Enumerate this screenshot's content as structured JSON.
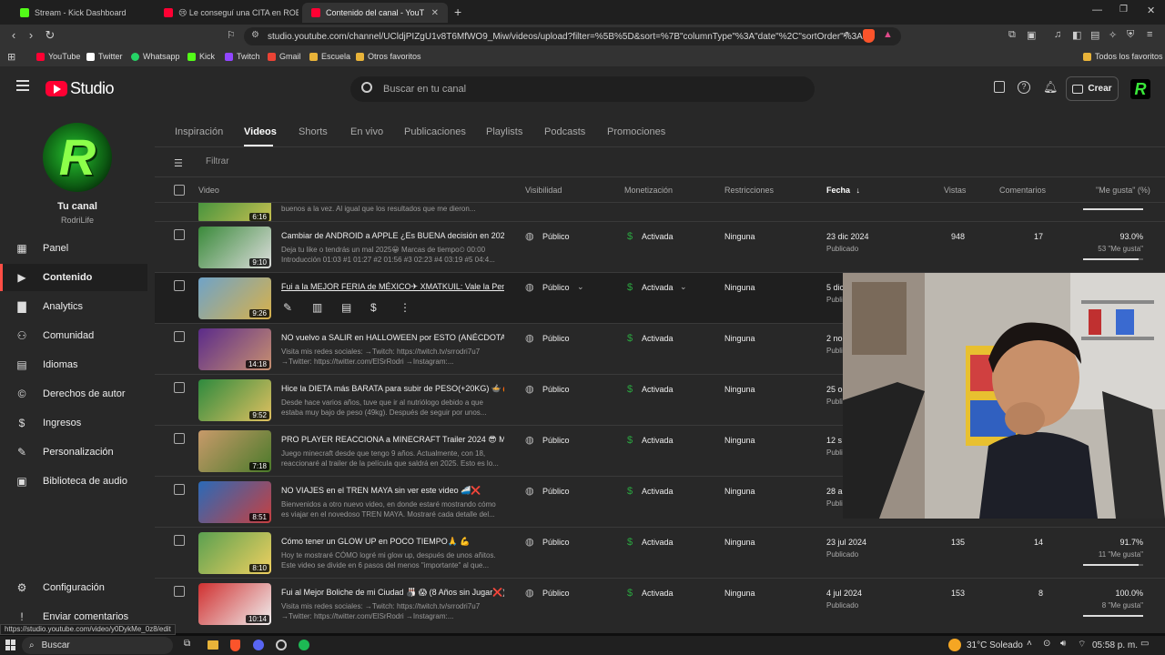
{
  "browser": {
    "tabs": [
      {
        "title": "Stream - Kick Dashboard",
        "active": false,
        "color": "#53fc18"
      },
      {
        "title": "😢 Le conseguí una CITA en ROBLOX",
        "active": false,
        "color": "#ff0033"
      },
      {
        "title": "Contenido del canal - YouTube S",
        "active": true,
        "color": "#ff0033"
      }
    ],
    "url": "studio.youtube.com/channel/UCldjPIZgU1v8T6MfWO9_Miw/videos/upload?filter=%5B%5D&sort=%7B\"columnType\"%3A\"date\"%2C\"sortOrder\"%3A\"...",
    "bookmarks": [
      {
        "label": "YouTube",
        "color": "#ff0033"
      },
      {
        "label": "Twitter",
        "color": "#ffffff"
      },
      {
        "label": "Whatsapp",
        "color": "#25d366"
      },
      {
        "label": "Kick",
        "color": "#53fc18"
      },
      {
        "label": "Twitch",
        "color": "#9146ff"
      },
      {
        "label": "Gmail",
        "color": "#ea4335"
      },
      {
        "label": "Escuela",
        "color": "#e8b339"
      },
      {
        "label": "Otros favoritos",
        "color": "#e8b339"
      }
    ],
    "all_favorites": "Todos los favoritos"
  },
  "studio": {
    "logo_text": "Studio",
    "search_placeholder": "Buscar en tu canal",
    "create_label": "Crear"
  },
  "channel": {
    "title": "Tu canal",
    "name": "RodriLife"
  },
  "sidebar": {
    "items": [
      {
        "label": "Panel",
        "icon": "dashboard-icon",
        "glyph": "▦"
      },
      {
        "label": "Contenido",
        "icon": "content-icon",
        "glyph": "▶",
        "active": true
      },
      {
        "label": "Analytics",
        "icon": "analytics-icon",
        "glyph": "▇"
      },
      {
        "label": "Comunidad",
        "icon": "community-icon",
        "glyph": "⚇"
      },
      {
        "label": "Idiomas",
        "icon": "subtitles-icon",
        "glyph": "▤"
      },
      {
        "label": "Derechos de autor",
        "icon": "copyright-icon",
        "glyph": "©"
      },
      {
        "label": "Ingresos",
        "icon": "earn-icon",
        "glyph": "$"
      },
      {
        "label": "Personalización",
        "icon": "customization-icon",
        "glyph": "✎"
      },
      {
        "label": "Biblioteca de audio",
        "icon": "audio-library-icon",
        "glyph": "▣"
      }
    ],
    "settings": "Configuración",
    "feedback": "Enviar comentarios"
  },
  "content_tabs": [
    "Inspiración",
    "Videos",
    "Shorts",
    "En vivo",
    "Publicaciones",
    "Playlists",
    "Podcasts",
    "Promociones"
  ],
  "filter_placeholder": "Filtrar",
  "columns": {
    "video": "Video",
    "visibility": "Visibilidad",
    "monetization": "Monetización",
    "restrictions": "Restricciones",
    "date": "Fecha",
    "views": "Vistas",
    "comments": "Comentarios",
    "likes": "\"Me gusta\" (%)"
  },
  "partial_row": {
    "duration": "6:16",
    "desc": "buenos a la vez. Al igual que los resultados que me dieron..."
  },
  "videos": [
    {
      "title": "Cambiar de ANDROID a APPLE ¿Es BUENA decisión en 2025...",
      "desc1": "Deja tu like o tendrás un mal 2025😀 Marcas de tiempo⏲ 00:00",
      "desc2": "Introducción 01:03 #1 01:27 #2 01:56 #3 02:23 #4 03:19 #5 04:4...",
      "duration": "9:10",
      "visibility": "Público",
      "monetization": "Activada",
      "restrictions": "Ninguna",
      "date": "23 dic 2024",
      "status": "Publicado",
      "views": "948",
      "comments": "17",
      "likes_pct": "93.0%",
      "likes_count": "53 \"Me gusta\"",
      "likes_fraction": 0.93,
      "thumb": [
        "#3a8a3a",
        "#ddd"
      ]
    },
    {
      "title": "Fui a la MEJOR FERIA de MÉXICO✈ XMATKUIL: Vale la Pena?",
      "desc1": "",
      "desc2": "",
      "duration": "9:26",
      "visibility": "Público",
      "monetization": "Activada",
      "restrictions": "Ninguna",
      "date": "5 dic",
      "status": "Publi",
      "views": "",
      "comments": "",
      "likes_pct": "",
      "likes_count": "",
      "likes_fraction": 0,
      "thumb": [
        "#6fa3c8",
        "#d8b14a"
      ],
      "hovered": true
    },
    {
      "title": "NO vuelvo a SALIR en HALLOWEEN por ESTO (ANÉCDOTA)...",
      "desc1": "Visita mis redes sociales: →Twitch: https://twitch.tv/srrodri7u7",
      "desc2": "→Twitter: https://twitter.com/ElSrRodri →Instagram:...",
      "duration": "14:18",
      "visibility": "Público",
      "monetization": "Activada",
      "restrictions": "Ninguna",
      "date": "2 no",
      "status": "Publi",
      "views": "",
      "comments": "",
      "likes_pct": "",
      "likes_count": "",
      "likes_fraction": 0,
      "thumb": [
        "#5b2b8a",
        "#c89070"
      ]
    },
    {
      "title": "Hice la DIETA más BARATA para subir de PESO(+20KG) 🍲🔥",
      "desc1": "Desde hace varios años, tuve que ir al nutriólogo debido a que",
      "desc2": "estaba muy bajo de peso (49kg). Después de seguir por unos...",
      "duration": "9:52",
      "visibility": "Público",
      "monetization": "Activada",
      "restrictions": "Ninguna",
      "date": "25 o",
      "status": "Publi",
      "views": "",
      "comments": "",
      "likes_pct": "",
      "likes_count": "",
      "likes_fraction": 0,
      "thumb": [
        "#2e8a3e",
        "#e0c060"
      ]
    },
    {
      "title": "PRO PLAYER REACCIONA a MINECRAFT Trailer 2024 😎 MEJ...",
      "desc1": "Juego minecraft desde que tengo 9 años. Actualmente, con 18,",
      "desc2": "reaccionaré al trailer de la película que saldrá en 2025. Esto es lo...",
      "duration": "7:18",
      "visibility": "Público",
      "monetization": "Activada",
      "restrictions": "Ninguna",
      "date": "12 s",
      "status": "Publi",
      "views": "",
      "comments": "",
      "likes_pct": "",
      "likes_count": "",
      "likes_fraction": 0,
      "thumb": [
        "#c89a6a",
        "#4a7a2a"
      ]
    },
    {
      "title": "NO VIAJES en el TREN MAYA sin ver este video 🚄❌",
      "desc1": "Bienvenidos a otro nuevo video, en donde estaré mostrando cómo",
      "desc2": "es viajar en el novedoso TREN MAYA. Mostraré cada detalle del...",
      "duration": "8:51",
      "visibility": "Público",
      "monetization": "Activada",
      "restrictions": "Ninguna",
      "date": "28 a",
      "status": "Publi",
      "views": "",
      "comments": "",
      "likes_pct": "",
      "likes_count": "",
      "likes_fraction": 0,
      "thumb": [
        "#2a6ab8",
        "#c84040"
      ]
    },
    {
      "title": "Cómo tener un GLOW UP en POCO TIEMPO🙏 💪",
      "desc1": "Hoy te mostraré CÓMO logré mi glow up, después de unos añitos.",
      "desc2": "Este video se divide en 6 pasos del menos \"importante\" al que...",
      "duration": "8:10",
      "visibility": "Público",
      "monetization": "Activada",
      "restrictions": "Ninguna",
      "date": "23 jul 2024",
      "status": "Publicado",
      "views": "135",
      "comments": "14",
      "likes_pct": "91.7%",
      "likes_count": "11 \"Me gusta\"",
      "likes_fraction": 0.917,
      "thumb": [
        "#5aa050",
        "#f0d060"
      ]
    },
    {
      "title": "Fui al Mejor Boliche de mi Ciudad 🎳 😱 (8 Años sin Jugar❌)",
      "desc1": "Visita mis redes sociales: →Twitch: https://twitch.tv/srrodri7u7",
      "desc2": "→Twitter: https://twitter.com/ElSrRodri →Instagram:...",
      "duration": "10:14",
      "visibility": "Público",
      "monetization": "Activada",
      "restrictions": "Ninguna",
      "date": "4 jul 2024",
      "status": "Publicado",
      "views": "153",
      "comments": "8",
      "likes_pct": "100.0%",
      "likes_count": "8 \"Me gusta\"",
      "likes_fraction": 1.0,
      "thumb": [
        "#d03030",
        "#f0f0f0"
      ]
    }
  ],
  "status_url": "https://studio.youtube.com/video/y0DykMe_0z8/edit",
  "taskbar": {
    "search": "Buscar",
    "weather": "31°C  Soleado",
    "time": "05:58 p. m."
  }
}
